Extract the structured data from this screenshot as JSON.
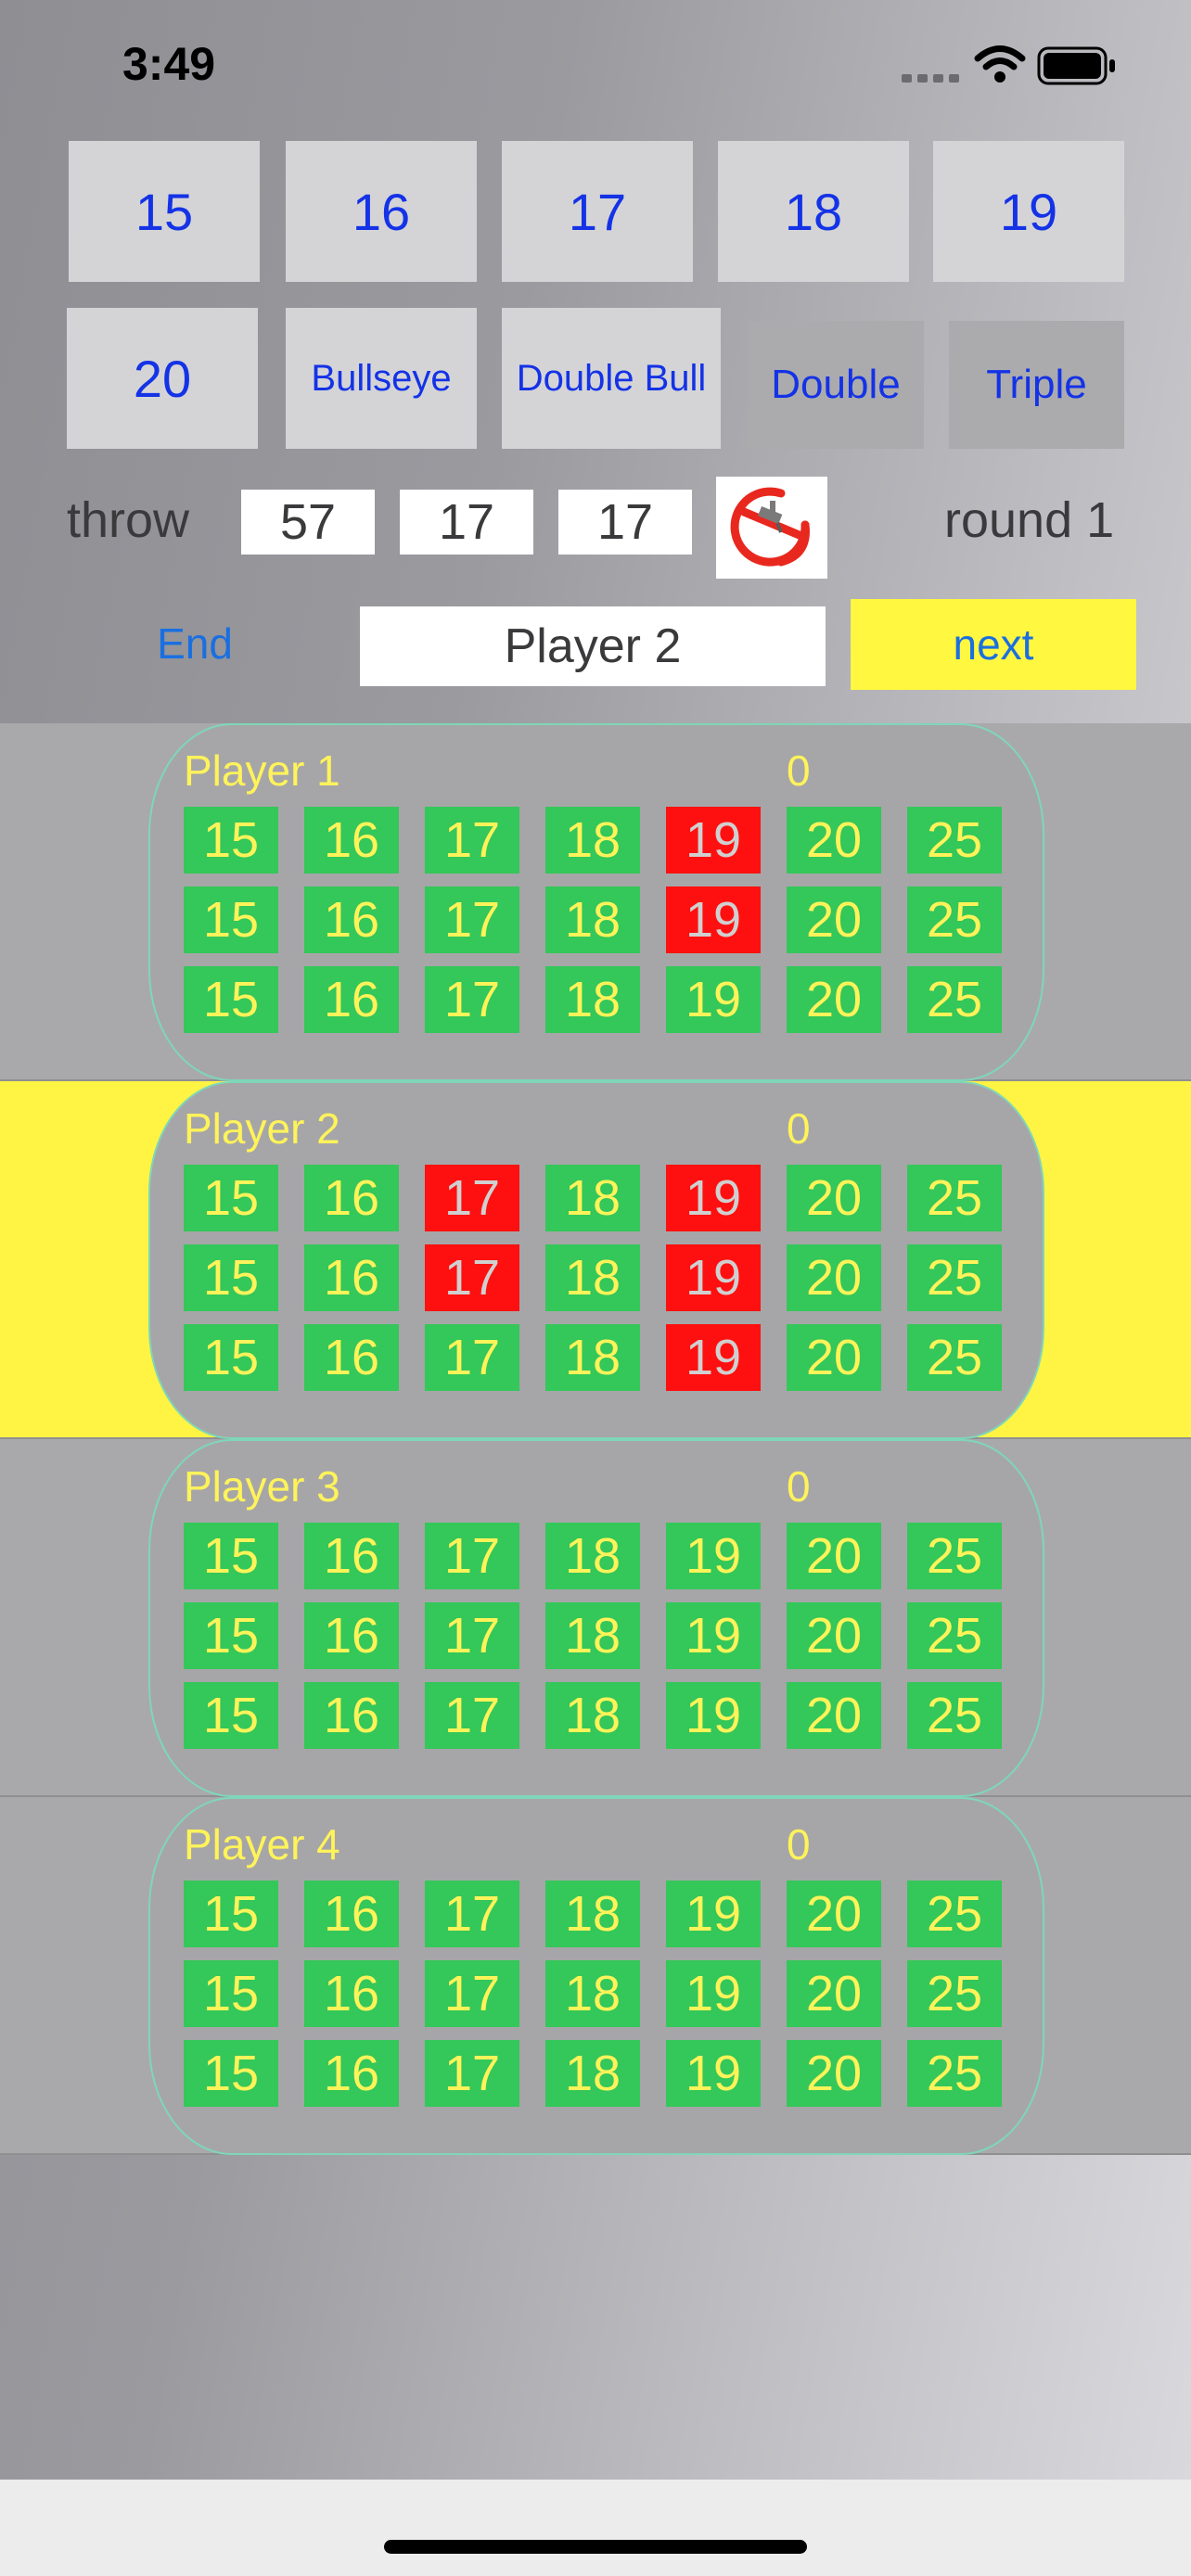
{
  "status": {
    "time": "3:49"
  },
  "keypad": {
    "row1": [
      "15",
      "16",
      "17",
      "18",
      "19"
    ],
    "row2": [
      "20",
      "Bullseye",
      "Double Bull"
    ],
    "double": "Double",
    "triple": "Triple"
  },
  "throw": {
    "label": "throw",
    "values": [
      "57",
      "17",
      "17"
    ],
    "round": "round 1"
  },
  "controls": {
    "end": "End",
    "current_player": "Player 2",
    "next": "next"
  },
  "players": [
    {
      "name": "Player 1",
      "score": "0",
      "active": false,
      "rows": [
        [
          {
            "v": "15",
            "hit": false
          },
          {
            "v": "16",
            "hit": false
          },
          {
            "v": "17",
            "hit": false
          },
          {
            "v": "18",
            "hit": false
          },
          {
            "v": "19",
            "hit": true
          },
          {
            "v": "20",
            "hit": false
          },
          {
            "v": "25",
            "hit": false
          }
        ],
        [
          {
            "v": "15",
            "hit": false
          },
          {
            "v": "16",
            "hit": false
          },
          {
            "v": "17",
            "hit": false
          },
          {
            "v": "18",
            "hit": false
          },
          {
            "v": "19",
            "hit": true
          },
          {
            "v": "20",
            "hit": false
          },
          {
            "v": "25",
            "hit": false
          }
        ],
        [
          {
            "v": "15",
            "hit": false
          },
          {
            "v": "16",
            "hit": false
          },
          {
            "v": "17",
            "hit": false
          },
          {
            "v": "18",
            "hit": false
          },
          {
            "v": "19",
            "hit": false
          },
          {
            "v": "20",
            "hit": false
          },
          {
            "v": "25",
            "hit": false
          }
        ]
      ]
    },
    {
      "name": "Player 2",
      "score": "0",
      "active": true,
      "rows": [
        [
          {
            "v": "15",
            "hit": false
          },
          {
            "v": "16",
            "hit": false
          },
          {
            "v": "17",
            "hit": true
          },
          {
            "v": "18",
            "hit": false
          },
          {
            "v": "19",
            "hit": true
          },
          {
            "v": "20",
            "hit": false
          },
          {
            "v": "25",
            "hit": false
          }
        ],
        [
          {
            "v": "15",
            "hit": false
          },
          {
            "v": "16",
            "hit": false
          },
          {
            "v": "17",
            "hit": true
          },
          {
            "v": "18",
            "hit": false
          },
          {
            "v": "19",
            "hit": true
          },
          {
            "v": "20",
            "hit": false
          },
          {
            "v": "25",
            "hit": false
          }
        ],
        [
          {
            "v": "15",
            "hit": false
          },
          {
            "v": "16",
            "hit": false
          },
          {
            "v": "17",
            "hit": false
          },
          {
            "v": "18",
            "hit": false
          },
          {
            "v": "19",
            "hit": true
          },
          {
            "v": "20",
            "hit": false
          },
          {
            "v": "25",
            "hit": false
          }
        ]
      ]
    },
    {
      "name": "Player 3",
      "score": "0",
      "active": false,
      "rows": [
        [
          {
            "v": "15",
            "hit": false
          },
          {
            "v": "16",
            "hit": false
          },
          {
            "v": "17",
            "hit": false
          },
          {
            "v": "18",
            "hit": false
          },
          {
            "v": "19",
            "hit": false
          },
          {
            "v": "20",
            "hit": false
          },
          {
            "v": "25",
            "hit": false
          }
        ],
        [
          {
            "v": "15",
            "hit": false
          },
          {
            "v": "16",
            "hit": false
          },
          {
            "v": "17",
            "hit": false
          },
          {
            "v": "18",
            "hit": false
          },
          {
            "v": "19",
            "hit": false
          },
          {
            "v": "20",
            "hit": false
          },
          {
            "v": "25",
            "hit": false
          }
        ],
        [
          {
            "v": "15",
            "hit": false
          },
          {
            "v": "16",
            "hit": false
          },
          {
            "v": "17",
            "hit": false
          },
          {
            "v": "18",
            "hit": false
          },
          {
            "v": "19",
            "hit": false
          },
          {
            "v": "20",
            "hit": false
          },
          {
            "v": "25",
            "hit": false
          }
        ]
      ]
    },
    {
      "name": "Player 4",
      "score": "0",
      "active": false,
      "rows": [
        [
          {
            "v": "15",
            "hit": false
          },
          {
            "v": "16",
            "hit": false
          },
          {
            "v": "17",
            "hit": false
          },
          {
            "v": "18",
            "hit": false
          },
          {
            "v": "19",
            "hit": false
          },
          {
            "v": "20",
            "hit": false
          },
          {
            "v": "25",
            "hit": false
          }
        ],
        [
          {
            "v": "15",
            "hit": false
          },
          {
            "v": "16",
            "hit": false
          },
          {
            "v": "17",
            "hit": false
          },
          {
            "v": "18",
            "hit": false
          },
          {
            "v": "19",
            "hit": false
          },
          {
            "v": "20",
            "hit": false
          },
          {
            "v": "25",
            "hit": false
          }
        ],
        [
          {
            "v": "15",
            "hit": false
          },
          {
            "v": "16",
            "hit": false
          },
          {
            "v": "17",
            "hit": false
          },
          {
            "v": "18",
            "hit": false
          },
          {
            "v": "19",
            "hit": false
          },
          {
            "v": "20",
            "hit": false
          },
          {
            "v": "25",
            "hit": false
          }
        ]
      ]
    }
  ],
  "colors": {
    "cell_open": "#34c759",
    "cell_hit": "#ff1010",
    "active_panel": "#fff444",
    "key_text": "#1432e6"
  }
}
